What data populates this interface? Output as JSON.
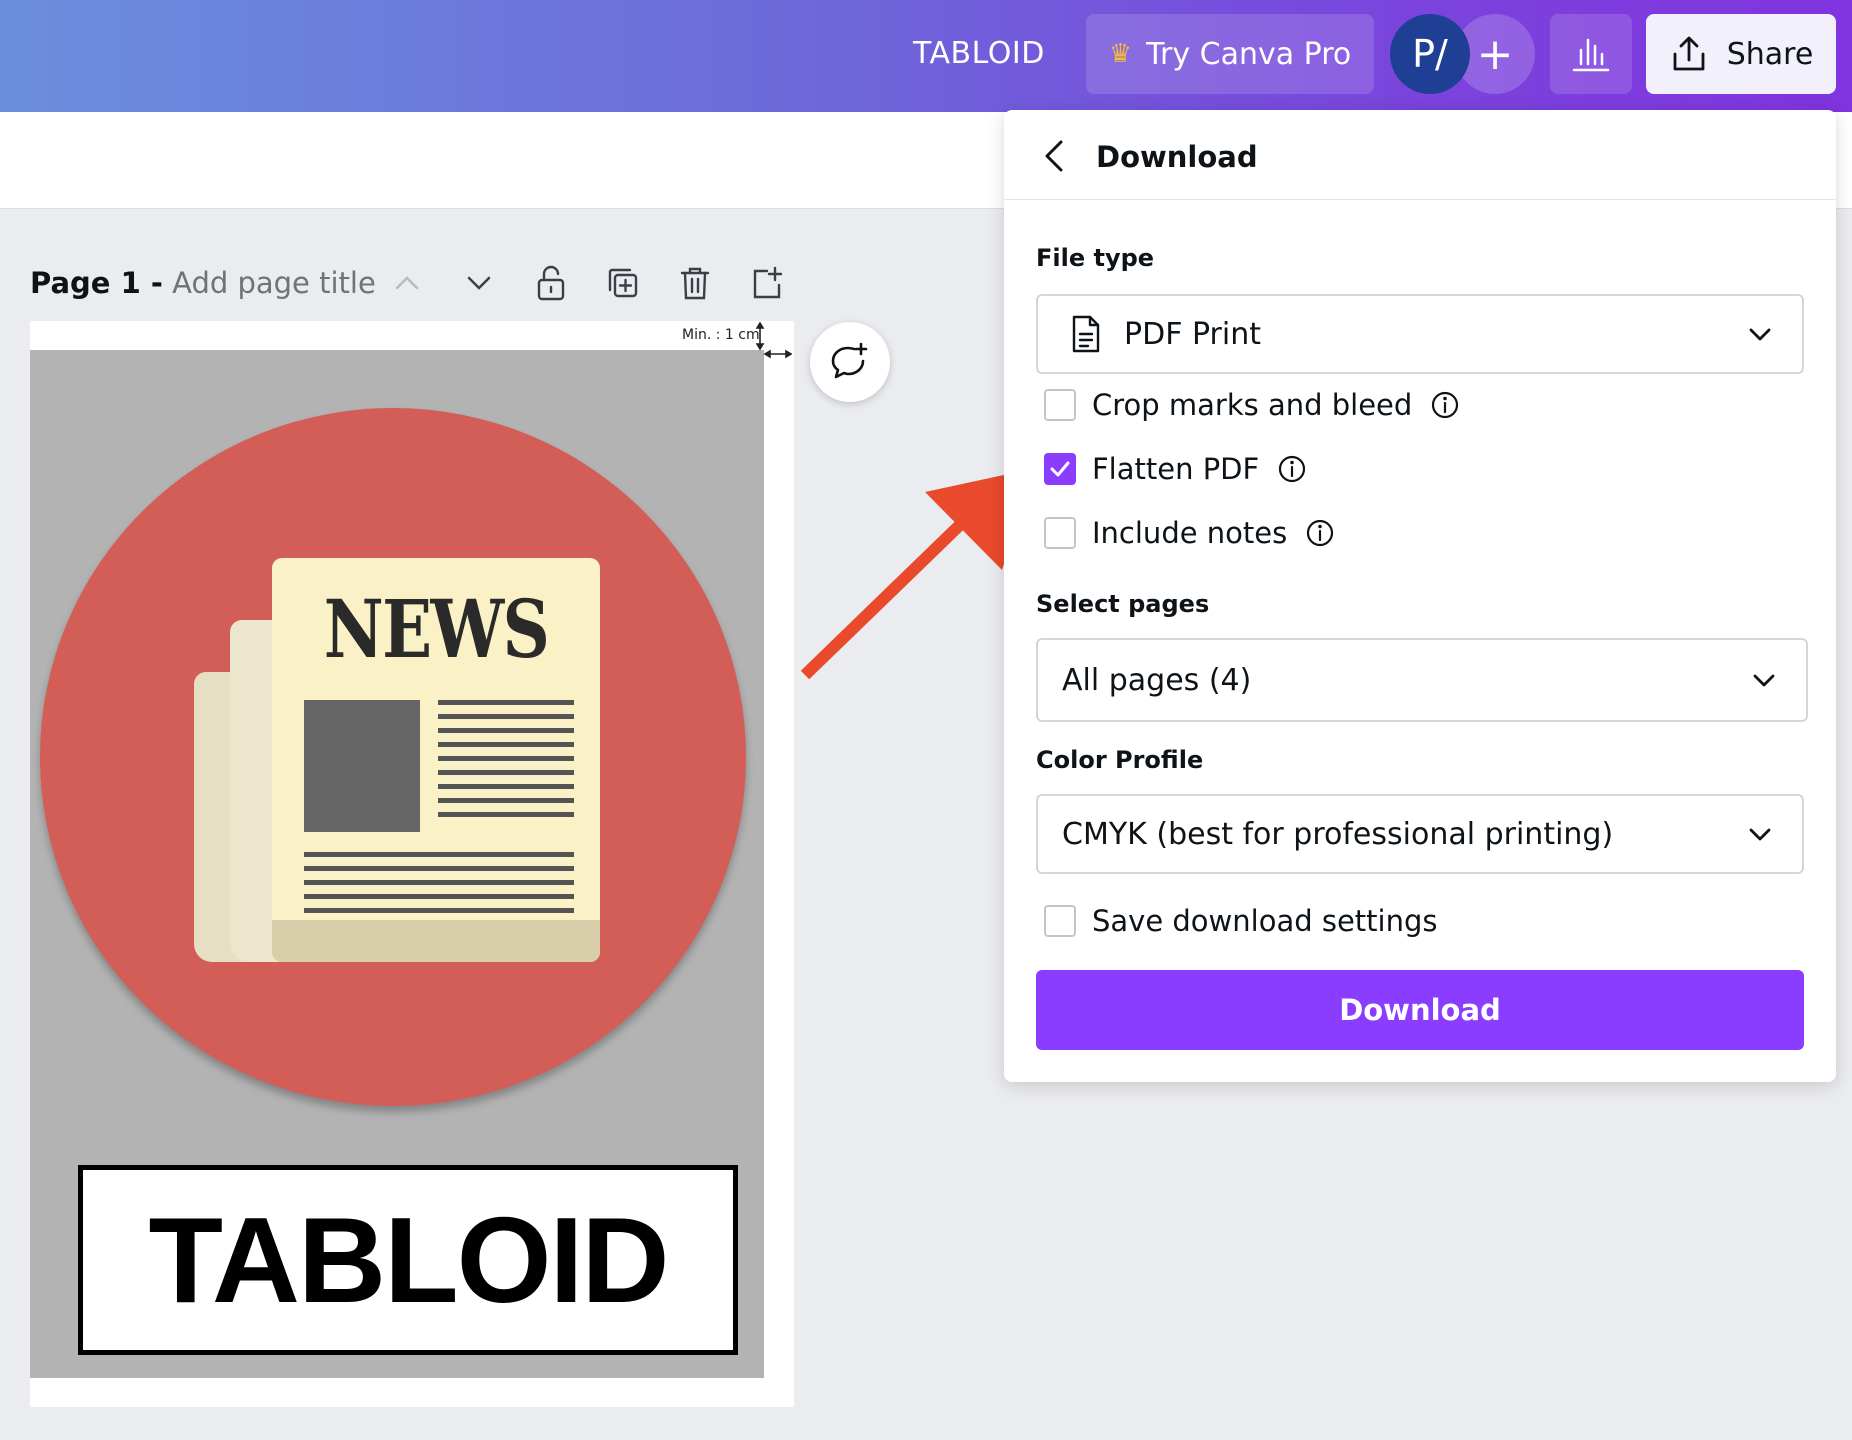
{
  "header": {
    "doc_title": "TABLOID",
    "try_pro_label": "Try Canva Pro",
    "avatar_initials": "P/",
    "add_label": "+",
    "share_label": "Share"
  },
  "page": {
    "number_label": "Page 1 -",
    "title_placeholder": "Add page title",
    "margin_label": "Min. : 1 cm"
  },
  "artwork": {
    "news_word": "NEWS",
    "tabloid_word": "TABLOID"
  },
  "panel": {
    "title": "Download",
    "file_type_label": "File type",
    "file_type_value": "PDF Print",
    "options": [
      {
        "label": "Crop marks and bleed",
        "checked": false
      },
      {
        "label": "Flatten PDF",
        "checked": true
      },
      {
        "label": "Include notes",
        "checked": false
      }
    ],
    "select_pages_label": "Select pages",
    "select_pages_value": "All pages (4)",
    "color_profile_label": "Color Profile",
    "color_profile_value": "CMYK (best for professional printing)",
    "save_settings_label": "Save download settings",
    "download_button": "Download"
  },
  "colors": {
    "accent": "#8b3dff",
    "annotation_arrow": "#e94a2c",
    "circle": "#d35e57"
  }
}
